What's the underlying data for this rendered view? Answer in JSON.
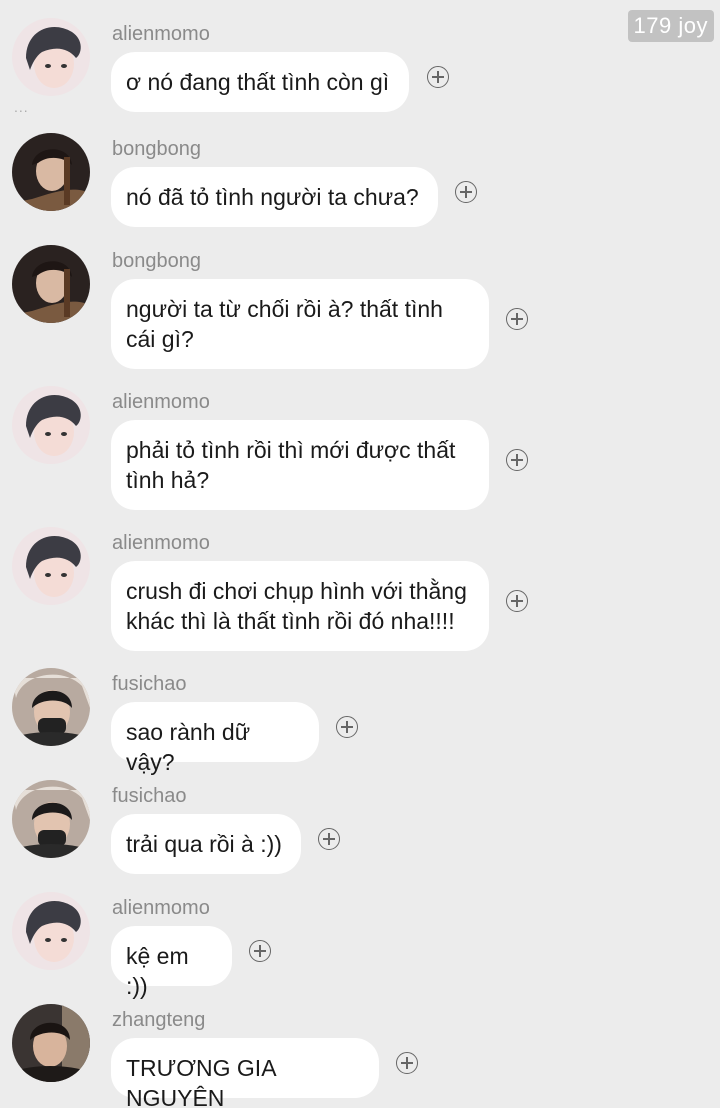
{
  "watermark": "179 joy",
  "typing_dots": "...",
  "messages": [
    {
      "user": "alienmomo",
      "text": "ơ nó đang thất tình còn gì",
      "avatar": "alienmomo"
    },
    {
      "user": "bongbong",
      "text": "nó đã tỏ tình người ta chưa?",
      "avatar": "bongbong"
    },
    {
      "user": "bongbong",
      "text": "người ta từ chối rồi à? thất tình cái gì?",
      "avatar": "bongbong"
    },
    {
      "user": "alienmomo",
      "text": "phải tỏ tình rồi thì mới được thất tình hả?",
      "avatar": "alienmomo"
    },
    {
      "user": "alienmomo",
      "text": "crush đi chơi chụp hình với thằng khác thì là thất tình rồi đó nha!!!!",
      "avatar": "alienmomo"
    },
    {
      "user": "fusichao",
      "text": "sao rành dữ vậy?",
      "avatar": "fusichao"
    },
    {
      "user": "fusichao",
      "text": "trải qua rồi à :))",
      "avatar": "fusichao"
    },
    {
      "user": "alienmomo",
      "text": "kệ em :))",
      "avatar": "alienmomo"
    },
    {
      "user": "zhangteng",
      "text": "TRƯƠNG GIA NGUYÊN",
      "avatar": "zhangteng"
    }
  ],
  "colors": {
    "background": "#ececec",
    "bubble": "#ffffff",
    "username": "#8a8a8a",
    "text": "#1a1a1a"
  },
  "icons": {
    "add_reaction": "plus-circle-icon"
  }
}
